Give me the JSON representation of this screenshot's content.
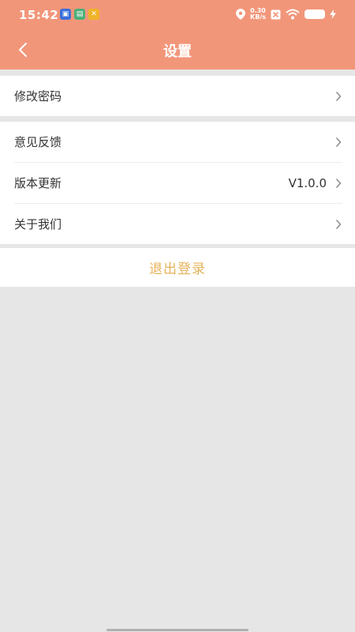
{
  "status_bar": {
    "time": "15:42",
    "net_speed_value": "0.30",
    "net_speed_unit": "KB/s"
  },
  "header": {
    "title": "设置",
    "background_color": "#f2967a"
  },
  "settings": {
    "group1": [
      {
        "label": "修改密码"
      }
    ],
    "group2": [
      {
        "label": "意见反馈"
      },
      {
        "label": "版本更新",
        "value": "V1.0.0"
      },
      {
        "label": "关于我们"
      }
    ]
  },
  "logout": {
    "label": "退出登录",
    "color": "#e6b25a"
  }
}
